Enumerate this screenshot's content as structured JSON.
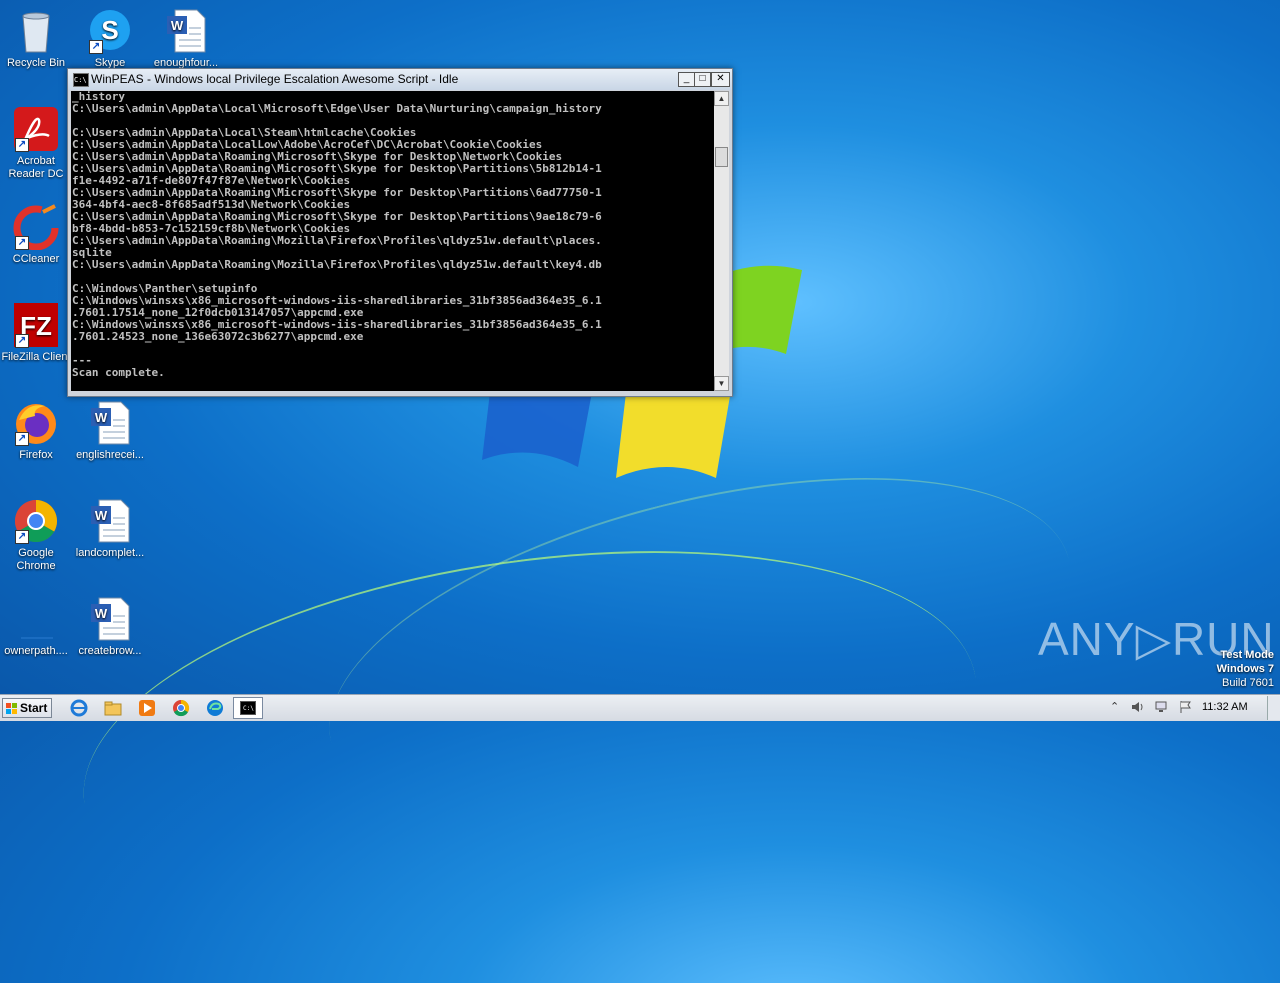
{
  "desktop": {
    "icons": [
      {
        "label": "Recycle Bin",
        "icon": "recycle-bin-icon"
      },
      {
        "label": "Skype",
        "icon": "skype-icon"
      },
      {
        "label": "enoughfour...",
        "icon": "word-document-icon"
      },
      {
        "label": "Acrobat Reader DC",
        "icon": "acrobat-icon"
      },
      {
        "label": "CCleaner",
        "icon": "ccleaner-icon"
      },
      {
        "label": "FileZilla Client",
        "icon": "filezilla-icon"
      },
      {
        "label": "Firefox",
        "icon": "firefox-icon"
      },
      {
        "label": "englishrecei...",
        "icon": "word-document-icon"
      },
      {
        "label": "Google Chrome",
        "icon": "chrome-icon"
      },
      {
        "label": "landcomplet...",
        "icon": "word-document-icon"
      },
      {
        "label": "ownerpath....",
        "icon": "blank-file-icon"
      },
      {
        "label": "createbrow...",
        "icon": "word-document-icon"
      }
    ]
  },
  "window": {
    "title": "WinPEAS - Windows local Privilege Escalation Awesome Script - Idle",
    "title_icon_text": "C:\\",
    "minimize": "_",
    "maximize": "□",
    "close": "✕",
    "console_text": "_history\nC:\\Users\\admin\\AppData\\Local\\Microsoft\\Edge\\User Data\\Nurturing\\campaign_history\n\nC:\\Users\\admin\\AppData\\Local\\Steam\\htmlcache\\Cookies\nC:\\Users\\admin\\AppData\\LocalLow\\Adobe\\AcroCef\\DC\\Acrobat\\Cookie\\Cookies\nC:\\Users\\admin\\AppData\\Roaming\\Microsoft\\Skype for Desktop\\Network\\Cookies\nC:\\Users\\admin\\AppData\\Roaming\\Microsoft\\Skype for Desktop\\Partitions\\5b812b14-1\nf1e-4492-a71f-de807f47f87e\\Network\\Cookies\nC:\\Users\\admin\\AppData\\Roaming\\Microsoft\\Skype for Desktop\\Partitions\\6ad77750-1\n364-4bf4-aec8-8f685adf513d\\Network\\Cookies\nC:\\Users\\admin\\AppData\\Roaming\\Microsoft\\Skype for Desktop\\Partitions\\9ae18c79-6\nbf8-4bdd-b853-7c152159cf8b\\Network\\Cookies\nC:\\Users\\admin\\AppData\\Roaming\\Mozilla\\Firefox\\Profiles\\qldyz51w.default\\places.\nsqlite\nC:\\Users\\admin\\AppData\\Roaming\\Mozilla\\Firefox\\Profiles\\qldyz51w.default\\key4.db\n\nC:\\Windows\\Panther\\setupinfo\nC:\\Windows\\winsxs\\x86_microsoft-windows-iis-sharedlibraries_31bf3856ad364e35_6.1\n.7601.17514_none_12f0dcb013147057\\appcmd.exe\nC:\\Windows\\winsxs\\x86_microsoft-windows-iis-sharedlibraries_31bf3856ad364e35_6.1\n.7601.24523_none_136e63072c3b6277\\appcmd.exe\n\n---\nScan complete."
  },
  "watermark": {
    "brand": "ANY▷RUN",
    "test_mode": "Test Mode",
    "os": "Windows 7",
    "build": "Build 7601"
  },
  "taskbar": {
    "start_label": "Start",
    "pinned": [
      "internet-explorer-icon",
      "explorer-folder-icon",
      "media-player-icon",
      "chrome-icon",
      "edge-icon",
      "console-icon"
    ],
    "clock": "11:32 AM",
    "tray_expand": "⌃"
  },
  "colors": {
    "desktop_blue": "#1f8fe0",
    "console_bg": "#000000",
    "console_fg": "#c0c0c0"
  }
}
